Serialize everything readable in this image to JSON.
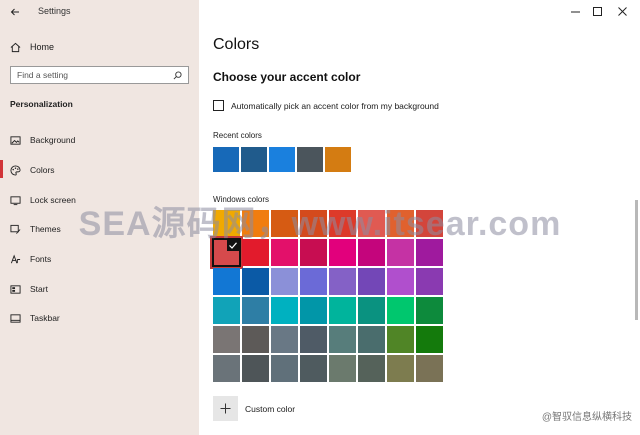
{
  "window": {
    "title": "Settings"
  },
  "sidebar": {
    "home": "Home",
    "search_placeholder": "Find a setting",
    "section": "Personalization",
    "items": [
      {
        "label": "Background",
        "icon": "image-icon"
      },
      {
        "label": "Colors",
        "icon": "palette-icon",
        "selected": true
      },
      {
        "label": "Lock screen",
        "icon": "monitor-icon"
      },
      {
        "label": "Themes",
        "icon": "brush-icon"
      },
      {
        "label": "Fonts",
        "icon": "font-icon"
      },
      {
        "label": "Start",
        "icon": "start-icon"
      },
      {
        "label": "Taskbar",
        "icon": "taskbar-icon"
      }
    ]
  },
  "main": {
    "title": "Colors",
    "subtitle": "Choose your accent color",
    "auto_pick": "Automatically pick an accent color from my background",
    "recent_label": "Recent colors",
    "recent_colors": [
      "#1769b8",
      "#205b8c",
      "#1a80de",
      "#4b555c",
      "#d47c12"
    ],
    "windows_label": "Windows colors",
    "windows_colors": [
      "#f1a900",
      "#f07d10",
      "#d65b13",
      "#d44a1d",
      "#dd3a2a",
      "#e05a52",
      "#e0612e",
      "#d3453b",
      "#d64a4c",
      "#e21b2c",
      "#e3106a",
      "#c70d51",
      "#e2007c",
      "#c4057c",
      "#c532a4",
      "#9f1a9e",
      "#1277d4",
      "#0b5aa6",
      "#8b90d8",
      "#6b6ad7",
      "#8461c6",
      "#7347b7",
      "#b04fcd",
      "#8a3ab1",
      "#11a3b8",
      "#2e7ea5",
      "#00b1c0",
      "#0196a8",
      "#00b49c",
      "#0a9280",
      "#00c76e",
      "#0d8a3c",
      "#7a7574",
      "#5d5a58",
      "#697885",
      "#4f5b66",
      "#577d7b",
      "#4a6d6d",
      "#508526",
      "#147a0c",
      "#6a7379",
      "#4e5558",
      "#60707a",
      "#4f5b5f",
      "#6b7a6d",
      "#55625a",
      "#7d7c4f",
      "#7a7256"
    ],
    "selected_index": 8,
    "custom_color": "Custom color"
  },
  "overlay": {
    "watermark": "SEA源码网，www.itsear.com",
    "footer": "@智驭信息纵横科技"
  }
}
